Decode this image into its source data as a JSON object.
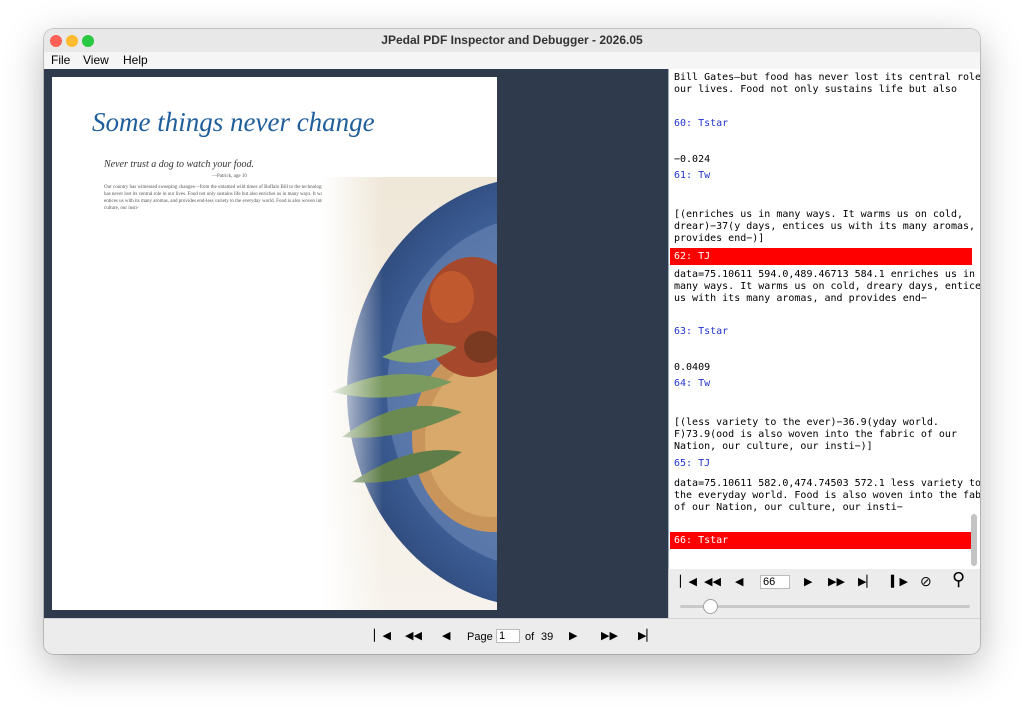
{
  "window": {
    "title": "JPedal PDF Inspector and Debugger - 2026.05"
  },
  "menu": {
    "items": [
      "File",
      "View",
      "Help"
    ]
  },
  "pdf_page": {
    "headline": "Some things never change",
    "quote": "Never trust a dog to watch your food.",
    "attribution": "—Patrick, age 10",
    "body": "Our country has witnessed sweeping changes—from the untamed wild times of Buffalo Bill to the technological era of Bill Gates—but food has never lost its central role in our lives. Food not only sustains life but also enriches us in many ways. It warms us on cold, dreary days, entices us with its many aromas, and provides end-less variety to the everyday world. Food is also woven into the fabric of our Nation, our culture, our insti-"
  },
  "debug_rows": [
    {
      "kind": "text",
      "text": "Bill Gates—but food has never lost its central role in"
    },
    {
      "kind": "text",
      "text": "our lives. Food not only sustains life but also"
    },
    {
      "kind": "op",
      "text": "60: Tstar"
    },
    {
      "kind": "text",
      "text": "−0.024"
    },
    {
      "kind": "op",
      "text": "61: Tw"
    },
    {
      "kind": "text",
      "text": "[(enriches us in many ways. It warms us on cold,"
    },
    {
      "kind": "text",
      "text": "drear)−37(y days, entices us with its many aromas, and"
    },
    {
      "kind": "text",
      "text": "provides end−)]"
    },
    {
      "kind": "op-hl",
      "text": "62: TJ"
    },
    {
      "kind": "text",
      "text": "data=75.10611 594.0,489.46713 584.1 enriches us in"
    },
    {
      "kind": "text",
      "text": "many ways. It warms us on cold, dreary days, entices"
    },
    {
      "kind": "text",
      "text": "us with its many aromas, and provides end−"
    },
    {
      "kind": "op",
      "text": "63: Tstar"
    },
    {
      "kind": "text",
      "text": "0.0409"
    },
    {
      "kind": "op",
      "text": "64: Tw"
    },
    {
      "kind": "text",
      "text": "[(less variety to the ever)−36.9(yday world."
    },
    {
      "kind": "text",
      "text": "F)73.9(ood is also woven into the fabric of our"
    },
    {
      "kind": "text",
      "text": "Nation, our culture, our insti−)]"
    },
    {
      "kind": "op",
      "text": "65: TJ"
    },
    {
      "kind": "text",
      "text": "data=75.10611 582.0,474.74503 572.1 less variety to"
    },
    {
      "kind": "text",
      "text": "the everyday world. Food is also woven into the fabric"
    },
    {
      "kind": "text",
      "text": "of our Nation, our culture, our insti−"
    },
    {
      "kind": "op-hl",
      "text": "66: Tstar"
    }
  ],
  "debugger": {
    "step_value": "66",
    "slider_fraction": 0.1
  },
  "nav": {
    "page_label": "Page",
    "current_page": "1",
    "of_label": "of",
    "total_pages": "39"
  },
  "icons": {
    "first": "first-page-icon",
    "back10": "rewind-icon",
    "prev": "prev-icon",
    "next": "next-icon",
    "fwd10": "fast-forward-icon",
    "last": "last-page-icon",
    "step": "step-icon",
    "cancel": "cancel-icon",
    "search": "search-icon"
  },
  "colors": {
    "highlight": "#ff0000",
    "operator": "#2233cc",
    "headline": "#1f5e9a",
    "viewer_bg": "#2f3a4d"
  }
}
